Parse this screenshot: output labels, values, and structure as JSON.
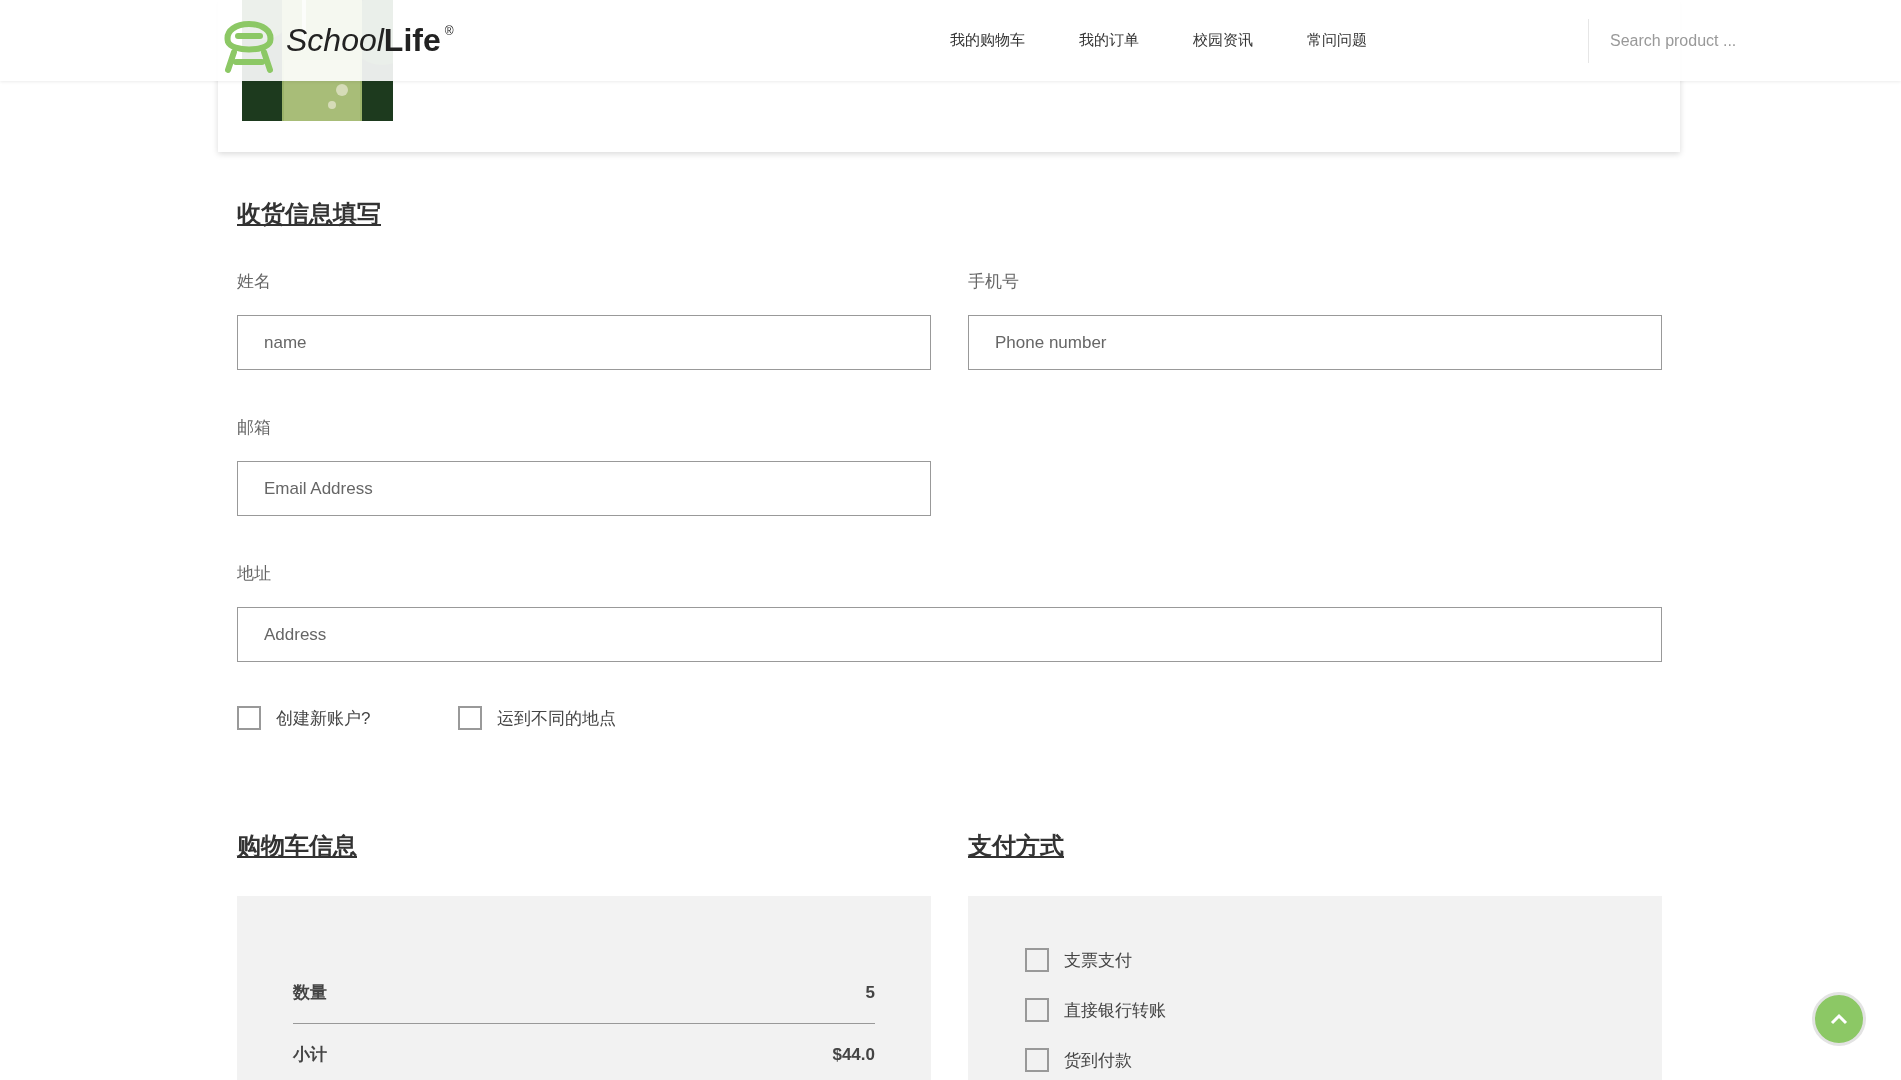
{
  "header": {
    "logo": {
      "name": "School",
      "accent": "Life",
      "mark": "®"
    },
    "nav": [
      {
        "label": "我的购物车"
      },
      {
        "label": "我的订单"
      },
      {
        "label": "校园资讯"
      },
      {
        "label": "常问问题"
      }
    ],
    "search": {
      "placeholder": "Search product ..."
    }
  },
  "shipping": {
    "title": "收货信息填写",
    "fields": [
      {
        "label": "姓名",
        "placeholder": "name"
      },
      {
        "label": "手机号",
        "placeholder": "Phone number"
      },
      {
        "label": "邮箱",
        "placeholder": "Email Address"
      },
      {
        "label": "地址",
        "placeholder": "Address"
      }
    ],
    "options": [
      {
        "label": "创建新账户?",
        "checked": false
      },
      {
        "label": "运到不同的地点",
        "checked": false
      }
    ]
  },
  "cart_info": {
    "title": "购物车信息",
    "rows": [
      {
        "label": "数量",
        "value": "5"
      },
      {
        "label": "小计",
        "value": "$44.0"
      }
    ]
  },
  "payment": {
    "title": "支付方式",
    "methods": [
      {
        "label": "支票支付",
        "checked": false
      },
      {
        "label": "直接银行转账",
        "checked": false
      },
      {
        "label": "货到付款",
        "checked": false
      }
    ]
  }
}
